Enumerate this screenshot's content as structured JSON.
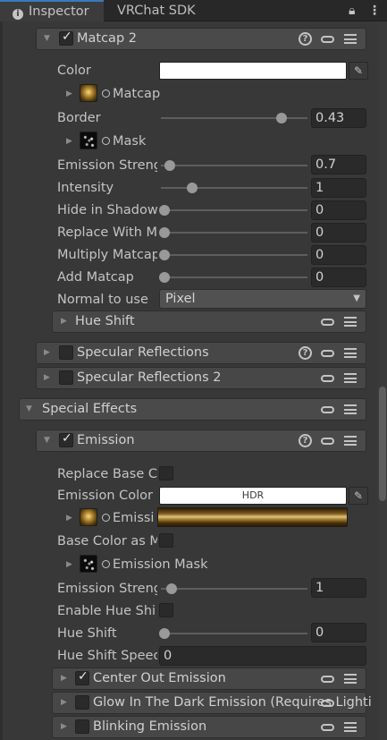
{
  "tabs": {
    "inspector": "Inspector",
    "vrchat_sdk": "VRChat SDK"
  },
  "matcap2": {
    "header": "Matcap 2",
    "enabled": true,
    "color_label": "Color",
    "color_value": "#ffffff",
    "matcap_texture_label": "Matcap",
    "border_label": "Border",
    "border_value": "0.43",
    "mask_texture_label": "Mask",
    "emission_strength_label": "Emission Streng",
    "emission_strength_value": "0.7",
    "intensity_label": "Intensity",
    "intensity_value": "1",
    "hide_in_shadow_label": "Hide in Shadow",
    "hide_in_shadow_value": "0",
    "replace_with_label": "Replace With M",
    "replace_with_value": "0",
    "multiply_label": "Multiply Matcap",
    "multiply_value": "0",
    "add_label": "Add Matcap",
    "add_value": "0",
    "normal_label": "Normal to use",
    "normal_value": "Pixel",
    "hue_shift_header": "Hue Shift"
  },
  "specular_1": {
    "header": "Specular Reflections",
    "enabled": false
  },
  "specular_2": {
    "header": "Specular Reflections 2",
    "enabled": false
  },
  "special_effects": {
    "header": "Special Effects"
  },
  "emission": {
    "header": "Emission",
    "enabled": true,
    "replace_base_label": "Replace Base C",
    "replace_base_checked": false,
    "emission_color_label": "Emission Color",
    "emission_color_badge": "HDR",
    "emission_texture_label": "Emissi",
    "base_color_as_label": "Base Color as M",
    "base_color_as_checked": false,
    "emission_mask_label": "Emission Mask",
    "emission_strength_label": "Emission Streng",
    "emission_strength_value": "1",
    "enable_hue_shift_label": "Enable Hue Shi",
    "enable_hue_shift_checked": false,
    "hue_shift_label": "Hue Shift",
    "hue_shift_value": "0",
    "hue_shift_speed_label": "Hue Shift Speed",
    "hue_shift_speed_value": "0"
  },
  "sub_sections": {
    "center_out": {
      "header": "Center Out Emission",
      "enabled": true
    },
    "glow_dark": {
      "header": "Glow In The Dark Emission (Requires Lightin",
      "enabled": false
    },
    "blinking": {
      "header": "Blinking Emission",
      "enabled": false
    }
  },
  "colors": {
    "background": "#383838",
    "foldout": "#474747",
    "tab_accent": "#3a79bb",
    "field": "#2a2a2a"
  },
  "slider_levels": {
    "border": 0.43,
    "emission_strength_matcap": 0.07,
    "intensity": 0.22,
    "hide_in_shadow": 0,
    "replace_with": 0,
    "multiply": 0,
    "add": 0,
    "emission_strength": 0.05,
    "hue_shift": 0
  }
}
